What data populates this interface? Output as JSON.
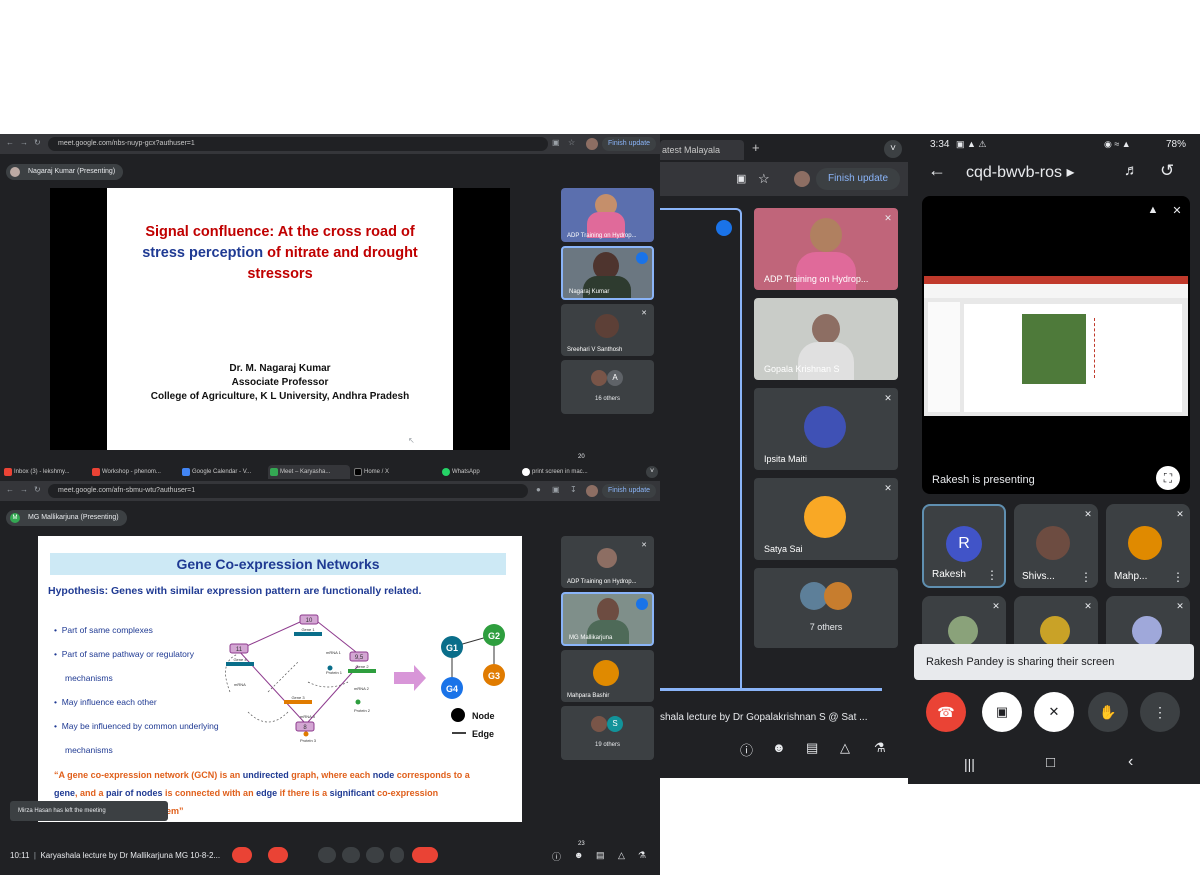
{
  "win1": {
    "url": "meet.google.com/nbs-nuyp-gcx?authuser=1",
    "finish_update": "Finish update",
    "presenter": "Nagaraj Kumar (Presenting)",
    "slide": {
      "title_red1": "Signal confluence: At the cross road of",
      "title_blue": "stress perception",
      "title_red2": " of nitrate and drought",
      "title_red3": "stressors",
      "author": "Dr. M. Nagaraj Kumar",
      "role": "Associate Professor",
      "org": "College of Agriculture,  K L University,  Andhra Pradesh"
    },
    "tiles": [
      {
        "name": "ADP Training on Hydrop..."
      },
      {
        "name": "Nagaraj Kumar"
      },
      {
        "name": "Sreehari V Santhosh"
      },
      {
        "name": "16 others",
        "avatar": "A"
      }
    ],
    "count_badge": "20"
  },
  "tabs": [
    {
      "label": "Inbox (3) - lekshmy..."
    },
    {
      "label": "Workshop - phenom..."
    },
    {
      "label": "Google Calendar - V..."
    },
    {
      "label": "Meet – Karyasha..."
    },
    {
      "label": "Home / X"
    },
    {
      "label": "WhatsApp"
    },
    {
      "label": "print screen in mac..."
    }
  ],
  "win2": {
    "url": "meet.google.com/afn-sbmu-wtu?authuser=1",
    "finish_update": "Finish update",
    "presenter": "MG Mallikarjuna (Presenting)",
    "presenter_avatar": "M",
    "slide": {
      "title": "Gene Co-expression Networks",
      "hypothesis": "Hypothesis: Genes with similar expression pattern are functionally related.",
      "bullets": [
        "Part of same complexes",
        "Part of same pathway or regulatory",
        "mechanisms",
        "May influence each other",
        "May be influenced by common underlying",
        "mechanisms"
      ],
      "diagram": {
        "n10": "10",
        "n11": "11",
        "n95": "9,5",
        "n8": "8",
        "gene1": "Gene 1",
        "gene2": "Gene 2",
        "gene3": "Gene 3",
        "gene4": "Gene 4",
        "mrna1": "mRNA 1",
        "mrna2": "mRNA 2",
        "mrna3": "mRNA 3",
        "mrna4": "mRNA",
        "prot1": "Protein 1",
        "prot2": "Protein 2",
        "prot3": "Protein 3",
        "g1": "G1",
        "g2": "G2",
        "g3": "G3",
        "g4": "G4",
        "node": "Node",
        "edge": "Edge"
      },
      "quote": {
        "p1": "“A gene co-expression network (GCN) is an ",
        "p2": "undirected",
        "p3": " graph, where each ",
        "p4": "node",
        "p5": " corresponds to a",
        "p6": "gene",
        "p7": ", and a ",
        "p8": "pair of nodes",
        "p9": " is connected with an ",
        "p10": "edge",
        "p11": " if there is a ",
        "p12": "significant",
        "p13": " co-expression",
        "p14": "em”"
      }
    },
    "toast": "Mirza Hasan has left the meeting",
    "tiles": [
      {
        "name": "ADP Training on Hydrop..."
      },
      {
        "name": "MG Mallikarjuna"
      },
      {
        "name": "Mahpara Bashir"
      },
      {
        "name": "19 others",
        "avatar": "S"
      }
    ],
    "count_badge": "23",
    "bottom_time": "10:11",
    "bottom_title": "Karyashala lecture by Dr Mallikarjuna MG 10-8-2..."
  },
  "win3": {
    "tab_label": "atest Malayala",
    "tab_plus": "+",
    "finish_update": "Finish update",
    "tiles": [
      {
        "name": "ADP Training on Hydrop..."
      },
      {
        "name": "Gopala Krishnan S"
      },
      {
        "name": "Ipsita Maiti"
      },
      {
        "name": "Satya Sai"
      },
      {
        "name": "7 others"
      }
    ],
    "bottom_title": "shala lecture by Dr Gopalakrishnan S @ Sat ..."
  },
  "phone": {
    "time": "3:34",
    "battery": "78%",
    "meeting_code": "cqd-bwvb-ros",
    "presenting_label": "Rakesh is presenting",
    "tiles": [
      {
        "name": "Rakesh",
        "avatar": "R"
      },
      {
        "name": "Shivs..."
      },
      {
        "name": "Mahp..."
      }
    ],
    "toast": "Rakesh Pandey is sharing their screen"
  },
  "colors": {
    "meet_bg": "#202124",
    "tile_bg": "#3c4043",
    "accent_blue": "#8ab4f8",
    "end_red": "#ea4335",
    "slide_red": "#c00000",
    "slide_blue": "#1f3a93",
    "quote_orange": "#e0601c"
  }
}
